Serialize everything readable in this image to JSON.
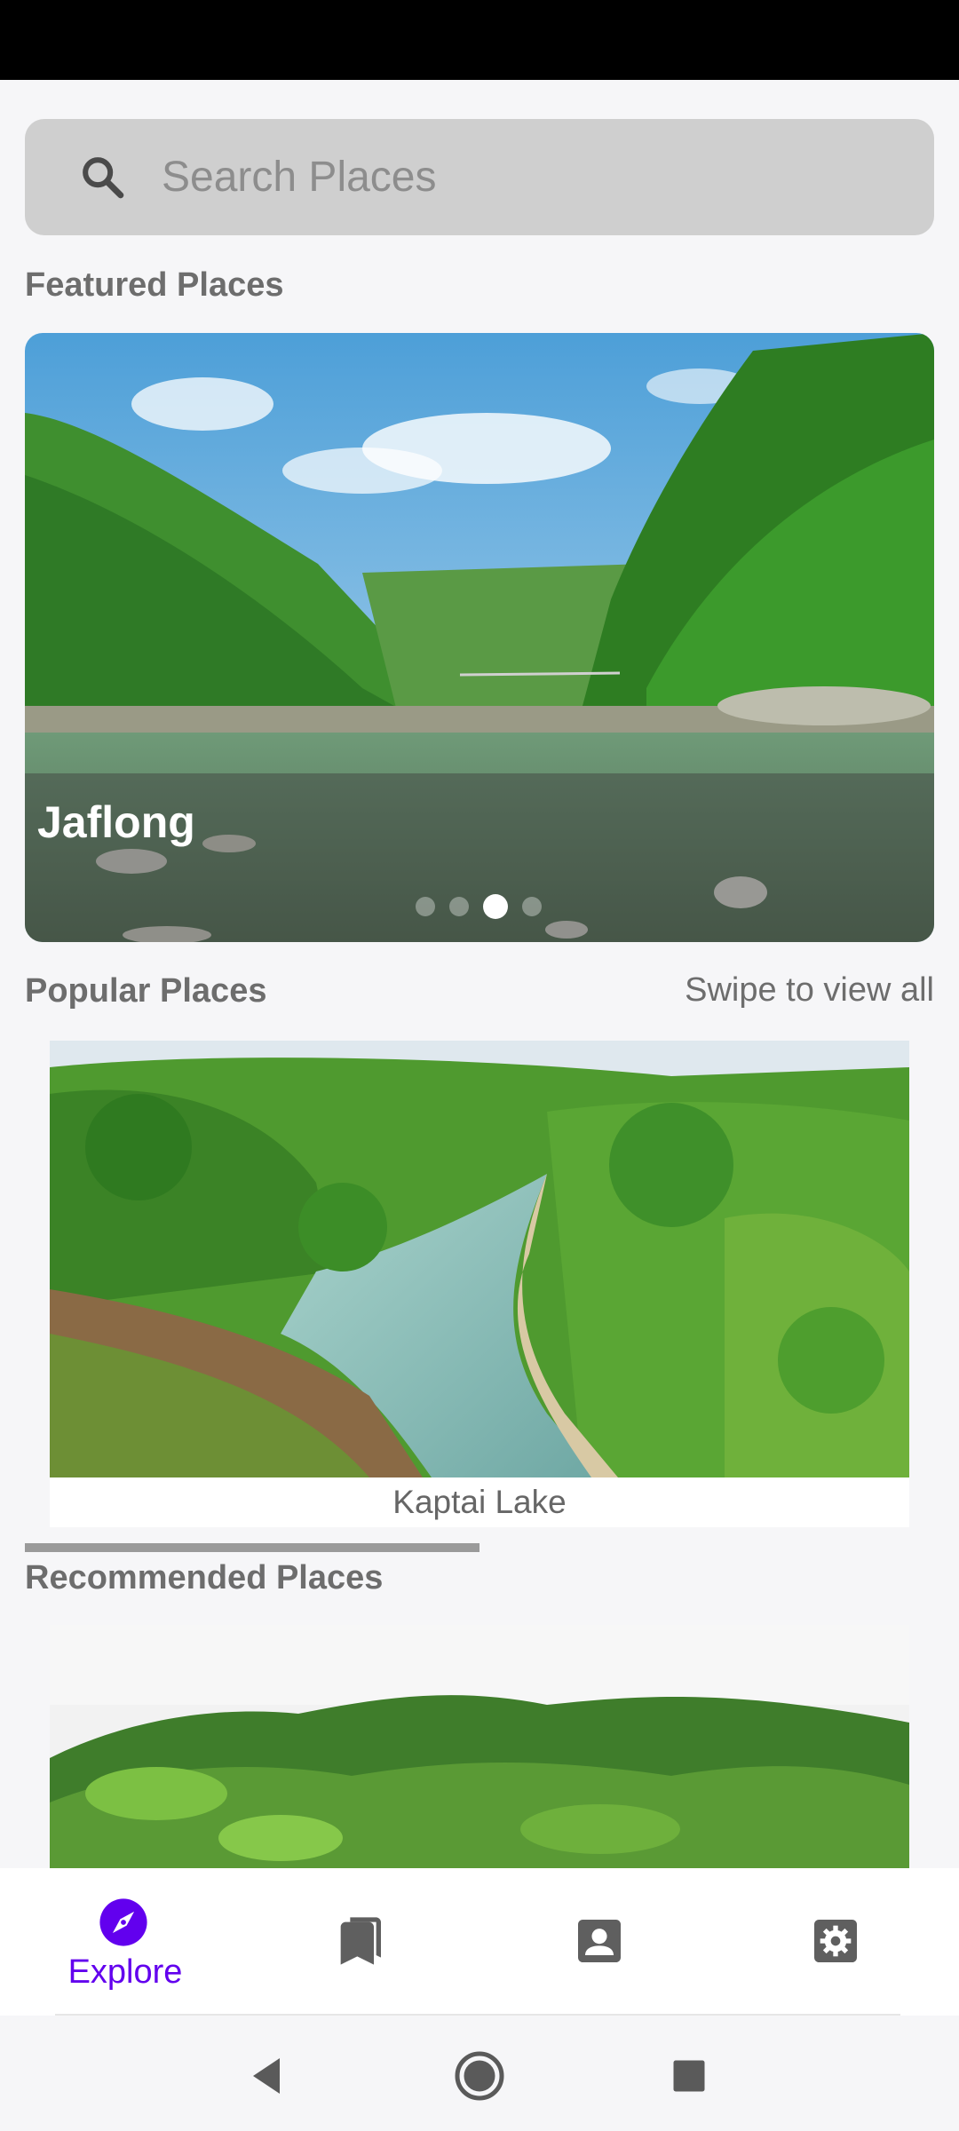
{
  "search": {
    "placeholder": "Search Places"
  },
  "featured": {
    "title": "Featured Places",
    "place_name": "Jaflong",
    "pager": {
      "count": 4,
      "active_index": 2
    }
  },
  "popular": {
    "title": "Popular Places",
    "swipe_hint": "Swipe to view all",
    "items": [
      {
        "name": "Kaptai Lake"
      }
    ]
  },
  "recommended": {
    "title": "Recommended Places"
  },
  "bottom_nav": {
    "items": [
      {
        "label": "Explore",
        "icon": "compass-icon",
        "active": true
      },
      {
        "label": "",
        "icon": "bookmarks-icon",
        "active": false
      },
      {
        "label": "",
        "icon": "contact-icon",
        "active": false
      },
      {
        "label": "",
        "icon": "settings-icon",
        "active": false
      }
    ]
  },
  "colors": {
    "accent": "#6200ee",
    "icon_inactive": "#5f5f5f",
    "search_bg": "#cfcfcf"
  }
}
